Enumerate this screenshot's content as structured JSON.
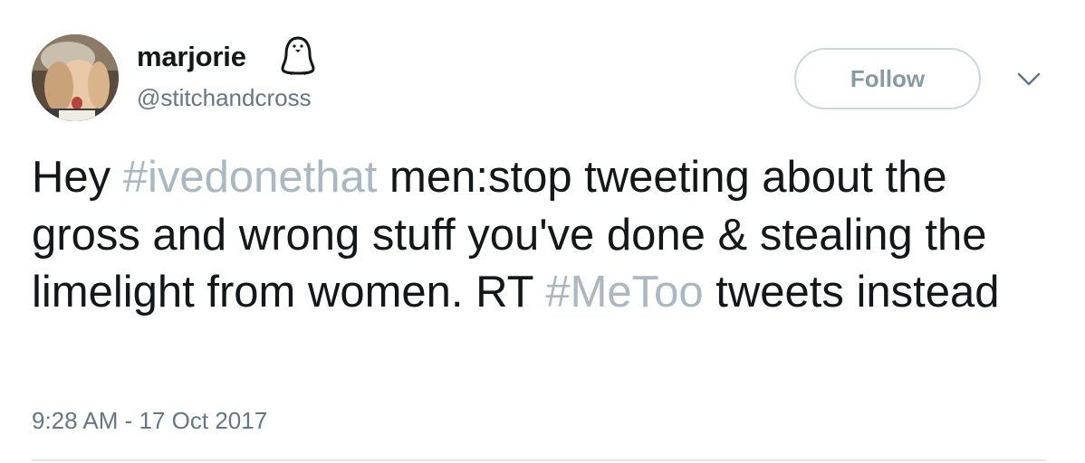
{
  "tweet": {
    "author": {
      "display_name": "marjorie",
      "name_emoji": "penguin-emoji",
      "handle": "@stitchandcross",
      "avatar": "avatar"
    },
    "follow_label": "Follow",
    "more_icon": "chevron-down-icon",
    "text": {
      "part1": "Hey ",
      "hashtag1": "#ivedonethat",
      "part2": " men:stop tweeting about the gross and wrong stuff you've done & stealing the limelight from women. RT ",
      "hashtag2": "#MeToo",
      "part3": " tweets instead"
    },
    "timestamp": "9:28 AM - 17 Oct 2017"
  },
  "colors": {
    "text": "#14171a",
    "secondary": "#657786",
    "hashtag": "#aab8c2",
    "button_border": "#ccd6dd",
    "button_text": "#8899a6",
    "divider": "#e1e8ed"
  }
}
